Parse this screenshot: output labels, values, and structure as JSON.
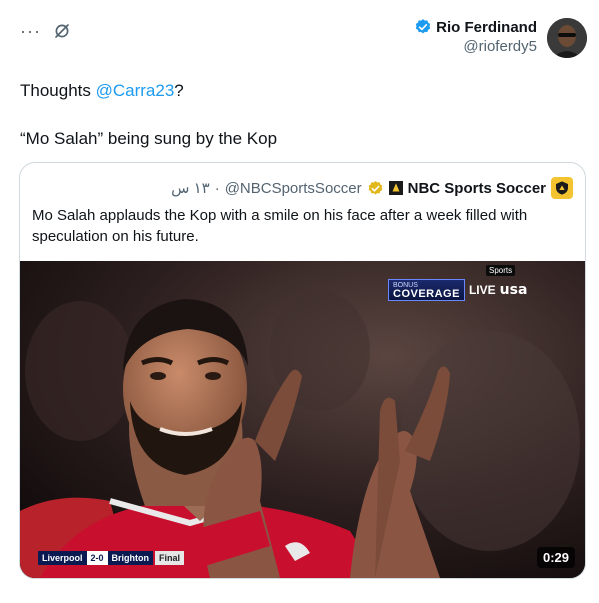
{
  "author": {
    "name": "Rio Ferdinand",
    "handle": "@rioferdy5"
  },
  "top_actions": {
    "more_label": "···"
  },
  "tweet": {
    "line1_prefix": "Thoughts ",
    "mention": "@Carra23",
    "line1_suffix": "?",
    "line2": "“Mo Salah” being sung by the Kop"
  },
  "quote": {
    "name": "NBC Sports Soccer",
    "handle": "@NBCSportsSoccer",
    "separator": "·",
    "time": "١٣ س",
    "text": "Mo Salah applauds the Kop with a smile on his face after a week filled with speculation on his future."
  },
  "media": {
    "coverage_small": "BONUS",
    "coverage_big": "COVERAGE",
    "live_label": "LIVE",
    "network_label": "usa",
    "badge_label": "Sports",
    "score": {
      "home": "Liverpool",
      "score": "2-0",
      "away": "Brighton",
      "status": "Final"
    },
    "duration": "0:29"
  },
  "colors": {
    "accent": "#1d9bf0",
    "verified_blue": "#1d9bf0",
    "verified_gold": "#e2b719",
    "muted_text": "#536471",
    "border": "#cfd9de"
  },
  "icons": {
    "more": "more-icon",
    "grok": "grok-icon",
    "verified": "verified-badge-icon",
    "gold_verified": "gold-verified-badge-icon"
  }
}
